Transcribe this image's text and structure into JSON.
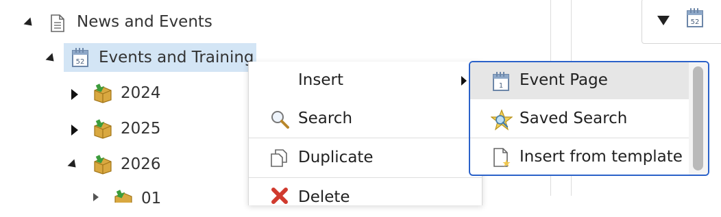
{
  "tree": {
    "news": "News and Events",
    "events": "Events and Training",
    "y2024": "2024",
    "y2025": "2025",
    "y2026": "2026",
    "partial": "01",
    "calendar_day": "52"
  },
  "context_menu": {
    "insert": "Insert",
    "search": "Search",
    "duplicate": "Duplicate",
    "delete": "Delete"
  },
  "submenu": {
    "event_page": "Event Page",
    "saved_search": "Saved Search",
    "insert_template": "Insert from template",
    "calendar_day": "1"
  },
  "toolbar": {
    "calendar_day": "52"
  }
}
